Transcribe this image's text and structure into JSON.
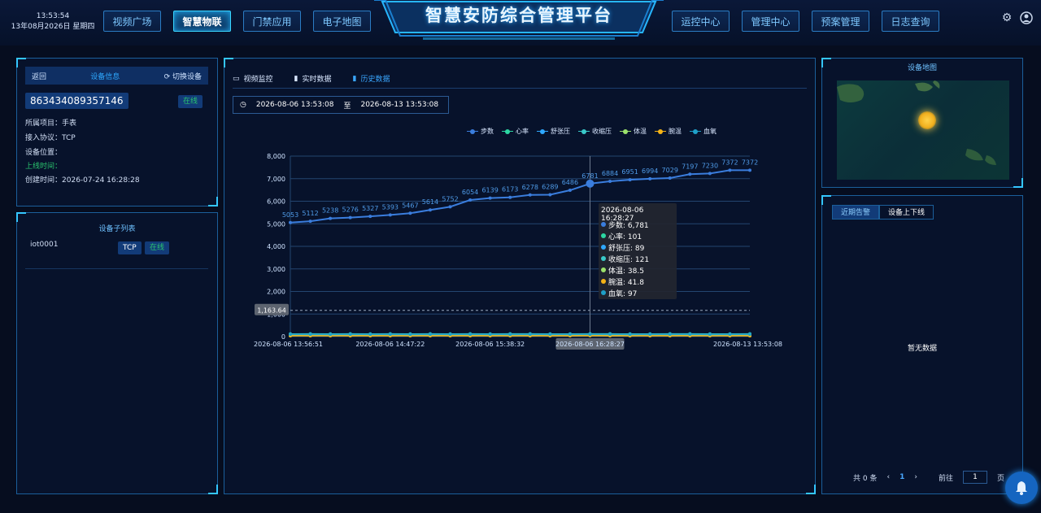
{
  "header": {
    "time": "13:53:54",
    "date": "13年08月2026日 星期四",
    "title": "智慧安防综合管理平台",
    "left_nav": [
      "视频广场",
      "智慧物联",
      "门禁应用",
      "电子地图"
    ],
    "right_nav": [
      "运控中心",
      "管理中心",
      "预案管理",
      "日志查询"
    ],
    "active_nav": "智慧物联",
    "icons": [
      "gear-icon",
      "user-icon"
    ]
  },
  "device_info": {
    "back_label": "返回",
    "title": "设备信息",
    "switch_label": "切换设备",
    "device_id": "863434089357146",
    "status": "在线",
    "project_label": "所属项目：",
    "project_value": "手表",
    "protocol_label": "接入协议：",
    "protocol_value": "TCP",
    "location_label": "设备位置：",
    "online_time_label": "上线时间：",
    "created_label": "创建时间：",
    "created_value": "2026-07-24 16:28:28"
  },
  "sub_list": {
    "title": "设备子列表",
    "items": [
      {
        "name": "iot0001",
        "protocol": "TCP",
        "status": "在线"
      }
    ]
  },
  "main": {
    "tabs": [
      "视频监控",
      "实时数据",
      "历史数据"
    ],
    "active_tab": "历史数据",
    "date_start": "2026-08-06 13:53:08",
    "date_sep": "至",
    "date_end": "2026-08-13 13:53:08"
  },
  "chart_data": {
    "type": "line",
    "series": [
      {
        "name": "步数",
        "color": "#3a7ddd",
        "values": [
          5053,
          5112,
          5238,
          5276,
          5327,
          5393,
          5467,
          5614,
          5752,
          6054,
          6139,
          6173,
          6278,
          6289,
          6486,
          6781,
          6884,
          6951,
          6994,
          7029,
          7197,
          7230,
          7372,
          7372
        ]
      },
      {
        "name": "心率",
        "color": "#2cd7a2",
        "values": [
          95,
          98,
          97,
          100,
          96,
          99,
          94,
          101,
          98,
          97,
          100,
          96,
          99,
          98,
          95,
          101,
          97,
          96,
          99,
          100,
          98,
          97,
          96,
          98
        ]
      },
      {
        "name": "舒张压",
        "color": "#2fa8ff",
        "values": [
          86,
          88,
          85,
          87,
          90,
          88,
          86,
          87,
          89,
          85,
          88,
          87,
          86,
          90,
          88,
          89,
          87,
          86,
          88,
          90,
          87,
          86,
          88,
          87
        ]
      },
      {
        "name": "收缩压",
        "color": "#39c9c9",
        "values": [
          118,
          120,
          119,
          122,
          117,
          121,
          118,
          120,
          119,
          122,
          118,
          120,
          121,
          119,
          117,
          121,
          120,
          118,
          119,
          122,
          120,
          118,
          119,
          121
        ]
      },
      {
        "name": "体温",
        "color": "#9be26b",
        "values": [
          36.6,
          36.8,
          36.5,
          36.7,
          37.0,
          36.6,
          36.8,
          36.9,
          36.7,
          36.5,
          36.8,
          36.6,
          36.7,
          37.1,
          36.9,
          38.5,
          36.8,
          36.6,
          36.7,
          36.9,
          36.8,
          36.6,
          36.7,
          36.8
        ]
      },
      {
        "name": "腕温",
        "color": "#f5b316",
        "values": [
          36.9,
          37.2,
          36.8,
          37.0,
          37.3,
          36.9,
          37.1,
          37.2,
          36.9,
          37.0,
          37.1,
          36.8,
          37.0,
          37.3,
          37.1,
          41.8,
          37.0,
          36.9,
          37.1,
          37.2,
          37.0,
          36.8,
          37.0,
          37.1
        ]
      },
      {
        "name": "血氧",
        "color": "#1ea0c8",
        "values": [
          97,
          98,
          96,
          97,
          98,
          97,
          96,
          98,
          97,
          97,
          98,
          96,
          97,
          98,
          97,
          97,
          98,
          96,
          97,
          98,
          97,
          96,
          97,
          98
        ]
      }
    ],
    "x_labels": [
      "2026-08-06 13:56:51",
      "2026-08-06 14:47:22",
      "2026-08-06 15:38:32",
      "2026-08-06 16:28:27",
      "2026-08-13 13:53:08"
    ],
    "y_ticks": [
      "0",
      "1,000",
      "2,000",
      "3,000",
      "4,000",
      "5,000",
      "6,000",
      "7,000",
      "8,000"
    ],
    "ylim": [
      0,
      8000
    ],
    "marker_line_label": "1,163.64",
    "marker_value": 1163.64,
    "tooltip": {
      "title": "2026-08-06 16:28:27",
      "rows": [
        "步数: 6,781",
        "心率: 101",
        "舒张压: 89",
        "收缩压: 121",
        "体温: 38.5",
        "腕温: 41.8",
        "血氧: 97"
      ]
    }
  },
  "right": {
    "map_title": "设备地图",
    "alarm_tabs": [
      "近期告警",
      "设备上下线"
    ],
    "no_data": "暂无数据",
    "pager_total": "共 0 条",
    "pager_page": "1",
    "pager_goto": "前往",
    "pager_page_unit": "页",
    "pager_input": "1",
    "prev_glyph": "‹",
    "next_glyph": "›"
  }
}
